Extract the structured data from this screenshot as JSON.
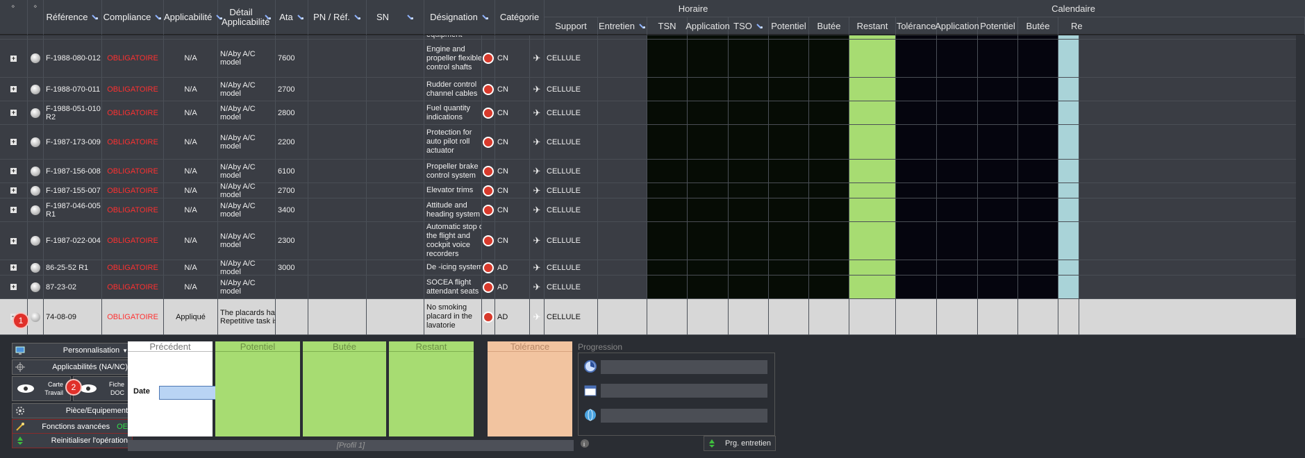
{
  "columns": {
    "reference": "Référence",
    "compliance": "Compliance",
    "applicabilite": "Applicabilité",
    "detail_applicabilite": "Détail Applicabilité",
    "ata": "Ata",
    "pn_ref": "PN / Réf.",
    "sn": "SN",
    "designation": "Désignation",
    "categorie": "Catégorie",
    "support": "Support",
    "entretien": "Entretien",
    "horaire_group": "Horaire",
    "calendaire_group": "Calendaire",
    "horaire": [
      "TSN",
      "Application",
      "TSO",
      "Potentiel",
      "Butée",
      "Restant"
    ],
    "calendaire": [
      "Tolérance",
      "Application",
      "Potentiel",
      "Butée",
      "Re"
    ]
  },
  "partial_row": {
    "designation": "equipment"
  },
  "rows": [
    {
      "reference": "F-1988-080-012",
      "compliance": "OBLIGATOIRE",
      "applicabilite": "N/A",
      "detail": "N/Aby A/C model",
      "ata": "7600",
      "designation_lines": [
        "Engine and",
        "propeller flexible",
        "control shafts"
      ],
      "categorie": "CN",
      "support": "CELLULE"
    },
    {
      "reference": "F-1988-070-011",
      "compliance": "OBLIGATOIRE",
      "applicabilite": "N/A",
      "detail": "N/Aby A/C model",
      "ata": "2700",
      "designation_lines": [
        "Rudder control",
        "channel cables"
      ],
      "categorie": "CN",
      "support": "CELLULE"
    },
    {
      "reference": "F-1988-051-010 R2",
      "compliance": "OBLIGATOIRE",
      "applicabilite": "N/A",
      "detail": "N/Aby A/C model",
      "ata": "2800",
      "designation_lines": [
        "Fuel quantity",
        "indications"
      ],
      "categorie": "CN",
      "support": "CELLULE"
    },
    {
      "reference": "F-1987-173-009",
      "compliance": "OBLIGATOIRE",
      "applicabilite": "N/A",
      "detail": "N/Aby A/C model",
      "ata": "2200",
      "designation_lines": [
        "Protection for",
        "auto pilot roll",
        "actuator"
      ],
      "categorie": "CN",
      "support": "CELLULE"
    },
    {
      "reference": "F-1987-156-008",
      "compliance": "OBLIGATOIRE",
      "applicabilite": "N/A",
      "detail": "N/Aby A/C model",
      "ata": "6100",
      "designation_lines": [
        "Propeller brake",
        "control system"
      ],
      "categorie": "CN",
      "support": "CELLULE"
    },
    {
      "reference": "F-1987-155-007",
      "compliance": "OBLIGATOIRE",
      "applicabilite": "N/A",
      "detail": "N/Aby A/C model",
      "ata": "2700",
      "designation_lines": [
        "Elevator trims"
      ],
      "categorie": "CN",
      "support": "CELLULE"
    },
    {
      "reference": "F-1987-046-005 R1",
      "compliance": "OBLIGATOIRE",
      "applicabilite": "N/A",
      "detail": "N/Aby A/C model",
      "ata": "3400",
      "designation_lines": [
        "Attitude and",
        "heading system"
      ],
      "categorie": "CN",
      "support": "CELLULE"
    },
    {
      "reference": "F-1987-022-004",
      "compliance": "OBLIGATOIRE",
      "applicabilite": "N/A",
      "detail": "N/Aby A/C model",
      "ata": "2300",
      "designation_lines": [
        "Automatic stop of",
        "the flight and",
        "cockpit voice",
        "recorders"
      ],
      "categorie": "CN",
      "support": "CELLULE"
    },
    {
      "reference": "86-25-52 R1",
      "compliance": "OBLIGATOIRE",
      "applicabilite": "N/A",
      "detail": "N/Aby A/C model",
      "ata": "3000",
      "designation_lines": [
        "De -icing system"
      ],
      "categorie": "AD",
      "support": "CELLULE"
    },
    {
      "reference": "87-23-02",
      "compliance": "OBLIGATOIRE",
      "applicabilite": "N/A",
      "detail": "N/Aby A/C model",
      "ata": "",
      "designation_lines": [
        "SOCEA flight",
        "attendant seats"
      ],
      "categorie": "AD",
      "support": "CELLULE"
    },
    {
      "reference": "74-08-09",
      "compliance": "OBLIGATOIRE",
      "applicabilite": "Appliqué",
      "detail_lines": [
        "The placards have",
        "Repetitive task is i"
      ],
      "ata": "",
      "designation_lines": [
        "No smoking",
        "placard in the",
        "lavatorie"
      ],
      "categorie": "AD",
      "support": "CELLULE",
      "selected": true
    }
  ],
  "markers": {
    "one": "1",
    "two": "2"
  },
  "panel": {
    "personnalisation": "Personnalisation",
    "applicabilites": "Applicabilités (NA/NC)",
    "carte_travail": [
      "Carte",
      "Travail"
    ],
    "fiche_doc": [
      "Fiche",
      "DOC"
    ],
    "piece_equipement": "Pièce/Equipement",
    "fonctions_avancees": "Fonctions avancées",
    "oe": "OE",
    "reinitialiser": "Reinitialiser l'opération",
    "precedent": "Précédent",
    "potentiel": "Potentiel",
    "butee": "Butée",
    "restant": "Restant",
    "tolerance": "Tolérance",
    "date_label": "Date",
    "date_value": "",
    "profil": "[Profil 1]",
    "progression": "Progression",
    "prg_entretien": "Prg. entretien"
  },
  "colors": {
    "green": "#a7dc72",
    "peach": "#f2c4a0",
    "red": "#ff3030"
  }
}
